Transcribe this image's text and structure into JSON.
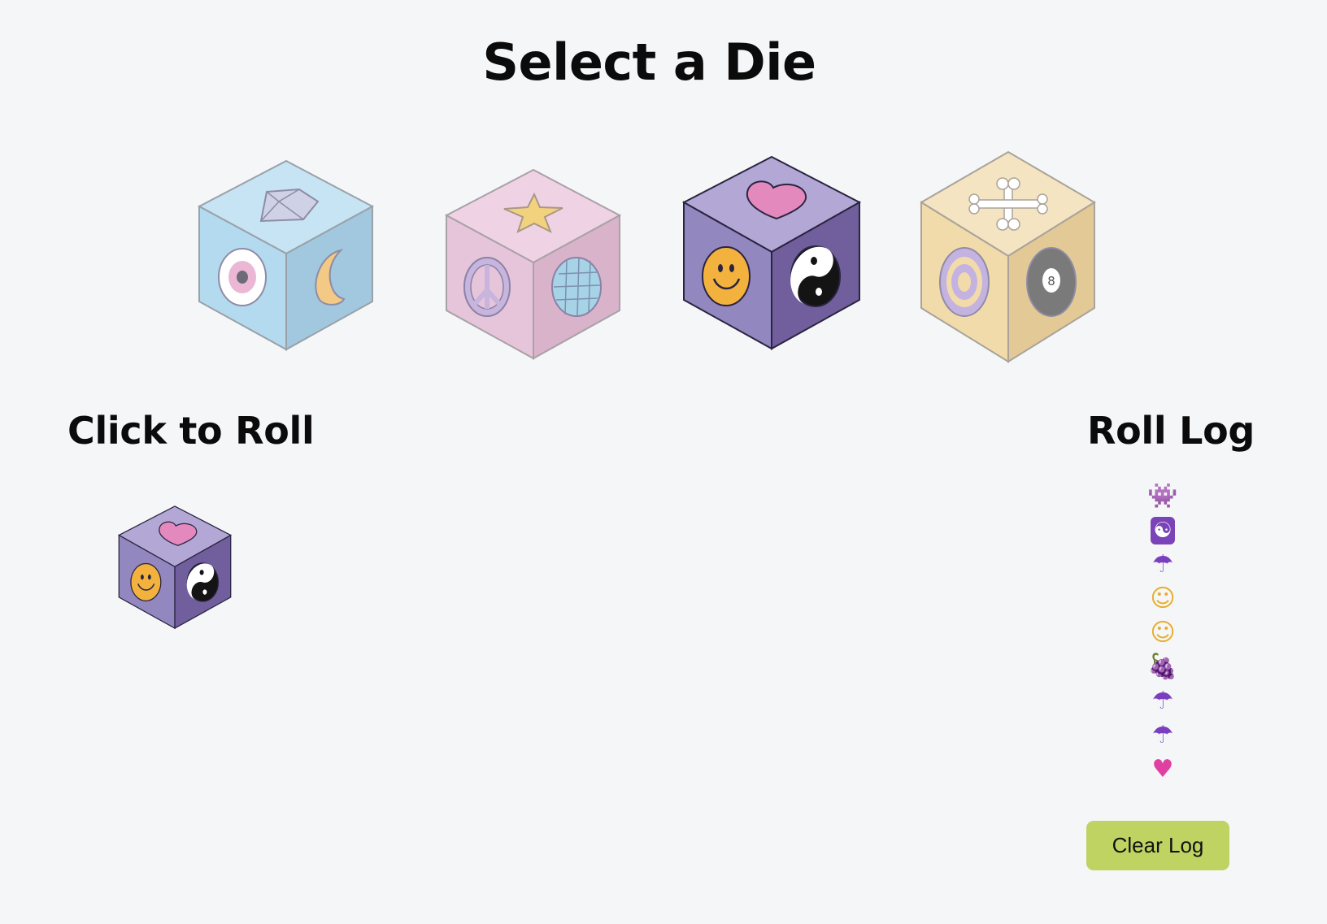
{
  "page": {
    "title": "Select a Die"
  },
  "dice": [
    {
      "name": "blue-die",
      "top": "#c6e4f3",
      "left": "#b3daee",
      "right": "#a1c8de",
      "stroke": "#9aa1a8",
      "faces": [
        "diamond-icon",
        "eye-icon",
        "moon-icon"
      ]
    },
    {
      "name": "pink-die",
      "top": "#efd3e4",
      "left": "#e6c5da",
      "right": "#d9b3ca",
      "stroke": "#a9a1a8",
      "faces": [
        "star-icon",
        "peace-icon",
        "globe-icon"
      ]
    },
    {
      "name": "purple-die",
      "top": "#b3a7d6",
      "left": "#9387c0",
      "right": "#705f9c",
      "stroke": "#2b2440",
      "faces": [
        "heart-icon",
        "smiley-icon",
        "yin-yang-icon"
      ]
    },
    {
      "name": "cream-die",
      "top": "#f4e4c1",
      "left": "#f1dbaa",
      "right": "#e2c996",
      "stroke": "#a9a39a",
      "faces": [
        "bone-icon",
        "target-icon",
        "eight-ball-icon"
      ]
    }
  ],
  "roll": {
    "heading": "Click to Roll",
    "selected_die": "purple-die"
  },
  "log": {
    "heading": "Roll Log",
    "entries": [
      {
        "icon": "space-invader-icon",
        "glyph": "👾",
        "color": "#6a4e9e"
      },
      {
        "icon": "yin-yang-icon",
        "glyph": "☯",
        "color": "#ffffff"
      },
      {
        "icon": "umbrella-icon",
        "glyph": "☂",
        "color": "#7a3fbf"
      },
      {
        "icon": "smiley-icon",
        "glyph": "☺",
        "color": "#e7ae2f"
      },
      {
        "icon": "smiley-icon",
        "glyph": "☺",
        "color": "#e7ae2f"
      },
      {
        "icon": "grapes-icon",
        "glyph": "🍇",
        "color": "#8a3a6f"
      },
      {
        "icon": "umbrella-icon",
        "glyph": "☂",
        "color": "#7a3fbf"
      },
      {
        "icon": "umbrella-icon",
        "glyph": "☂",
        "color": "#7a3fbf"
      },
      {
        "icon": "heart-icon",
        "glyph": "♥",
        "color": "#e040a0"
      }
    ],
    "clear_label": "Clear Log"
  }
}
